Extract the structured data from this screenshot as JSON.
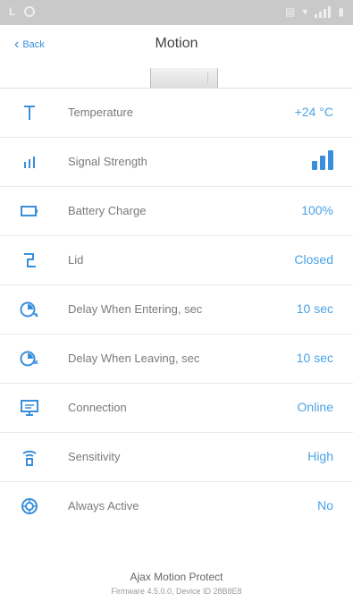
{
  "nav": {
    "back_label": "Back",
    "title": "Motion"
  },
  "rows": [
    {
      "label": "Temperature",
      "value": "+24 °C",
      "icon": "thermometer-icon"
    },
    {
      "label": "Signal Strength",
      "value": "",
      "icon": "signal-strength-icon",
      "signal_level": 3,
      "signal_max": 3
    },
    {
      "label": "Battery Charge",
      "value": "100%",
      "icon": "battery-icon"
    },
    {
      "label": "Lid",
      "value": "Closed",
      "icon": "lid-icon"
    },
    {
      "label": "Delay When Entering, sec",
      "value": "10 sec",
      "icon": "timer-enter-icon"
    },
    {
      "label": "Delay When Leaving, sec",
      "value": "10 sec",
      "icon": "timer-leave-icon"
    },
    {
      "label": "Connection",
      "value": "Online",
      "icon": "monitor-icon"
    },
    {
      "label": "Sensitivity",
      "value": "High",
      "icon": "sensitivity-icon"
    },
    {
      "label": "Always Active",
      "value": "No",
      "icon": "always-active-icon"
    }
  ],
  "footer": {
    "product": "Ajax Motion Protect",
    "info": "Firmware 4.5.0.0, Device ID 28B8E8"
  },
  "colors": {
    "accent": "#3a8fdc",
    "value_text": "#4aa3e6",
    "label_text": "#7a7a7a",
    "status_bar": "#c9c9c9"
  }
}
